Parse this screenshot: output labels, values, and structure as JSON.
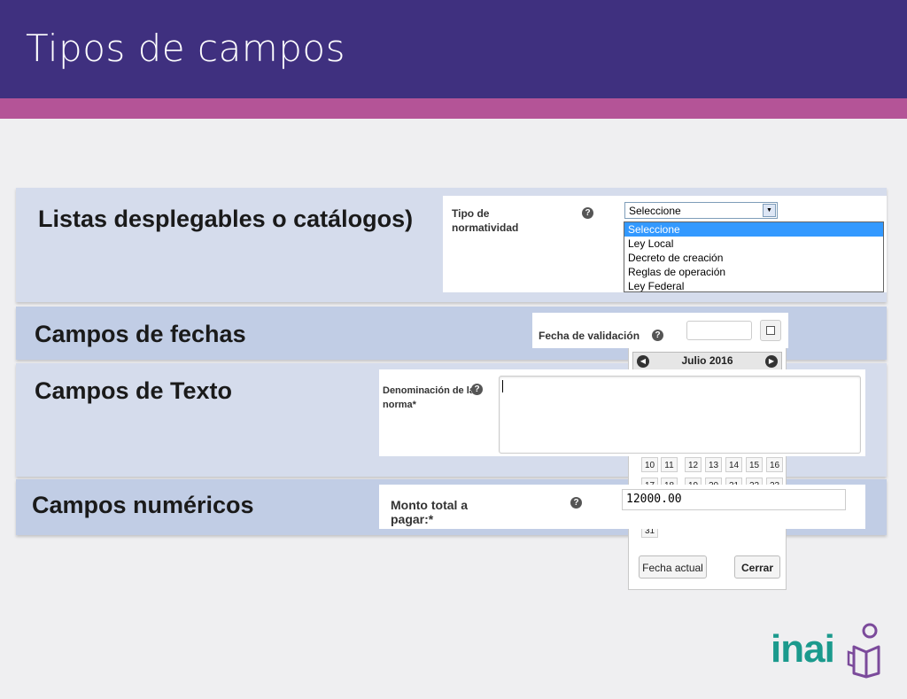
{
  "slide": {
    "title": "Tipos de campos"
  },
  "sections": {
    "lists": "Listas desplegables o catálogos)",
    "dates": "Campos de fechas",
    "text": "Campos de Texto",
    "numeric": "Campos numéricos"
  },
  "dropdown_example": {
    "label_line1": "Tipo de",
    "label_line2": "normatividad",
    "help_icon": "question-circle-icon",
    "selected": "Seleccione",
    "options": [
      "Seleccione",
      "Ley Local",
      "Decreto de creación",
      "Reglas de operación",
      "Ley Federal"
    ]
  },
  "date_example": {
    "label": "Fecha de validación",
    "value": "",
    "calendar": {
      "month_label": "Julio 2016",
      "visible_days": [
        "10",
        "11",
        "12",
        "13",
        "14",
        "15",
        "16"
      ],
      "partial_days": [
        "17",
        "18",
        "19",
        "20",
        "21",
        "22",
        "23"
      ],
      "last_day": "31",
      "today_button": "Fecha actual",
      "close_button": "Cerrar"
    }
  },
  "text_example": {
    "label_line1": "Denominación de la",
    "label_line2": "norma*",
    "value": ""
  },
  "numeric_example": {
    "label_line1": "Monto total a",
    "label_line2": "pagar:*",
    "value": "12000.00"
  },
  "logo": {
    "text": "inai",
    "colors": {
      "teal": "#1b9a8d",
      "purple": "#7b4a9b"
    }
  },
  "colors": {
    "header": "#3f307f",
    "accent_stripe": "#b45497",
    "band": "#d5dcec",
    "band_dark": "#c1cde5"
  }
}
